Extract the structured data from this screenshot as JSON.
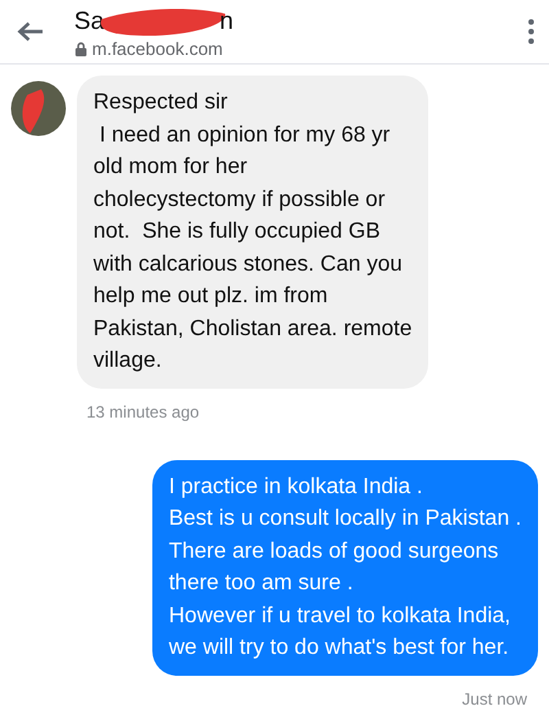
{
  "header": {
    "title_parts": [
      "Sa",
      "n"
    ],
    "redacted": true,
    "url": "m.facebook.com"
  },
  "messages": [
    {
      "kind": "received",
      "text": "Respected sir\n I need an opinion for my 68 yr\nold mom for her\ncholecystectomy if possible or\nnot.  She is fully occupied GB\nwith calcarious stones. Can you\nhelp me out plz. im from\nPakistan, Cholistan area. remote\nvillage.",
      "time": "13 minutes ago"
    },
    {
      "kind": "sent",
      "text": "I practice in kolkata India .\nBest is u consult locally in Pakistan .\nThere are loads of good surgeons\nthere too am sure .\nHowever if u travel to kolkata India,\nwe will try to do what's best for her.",
      "time": "Just now"
    }
  ]
}
